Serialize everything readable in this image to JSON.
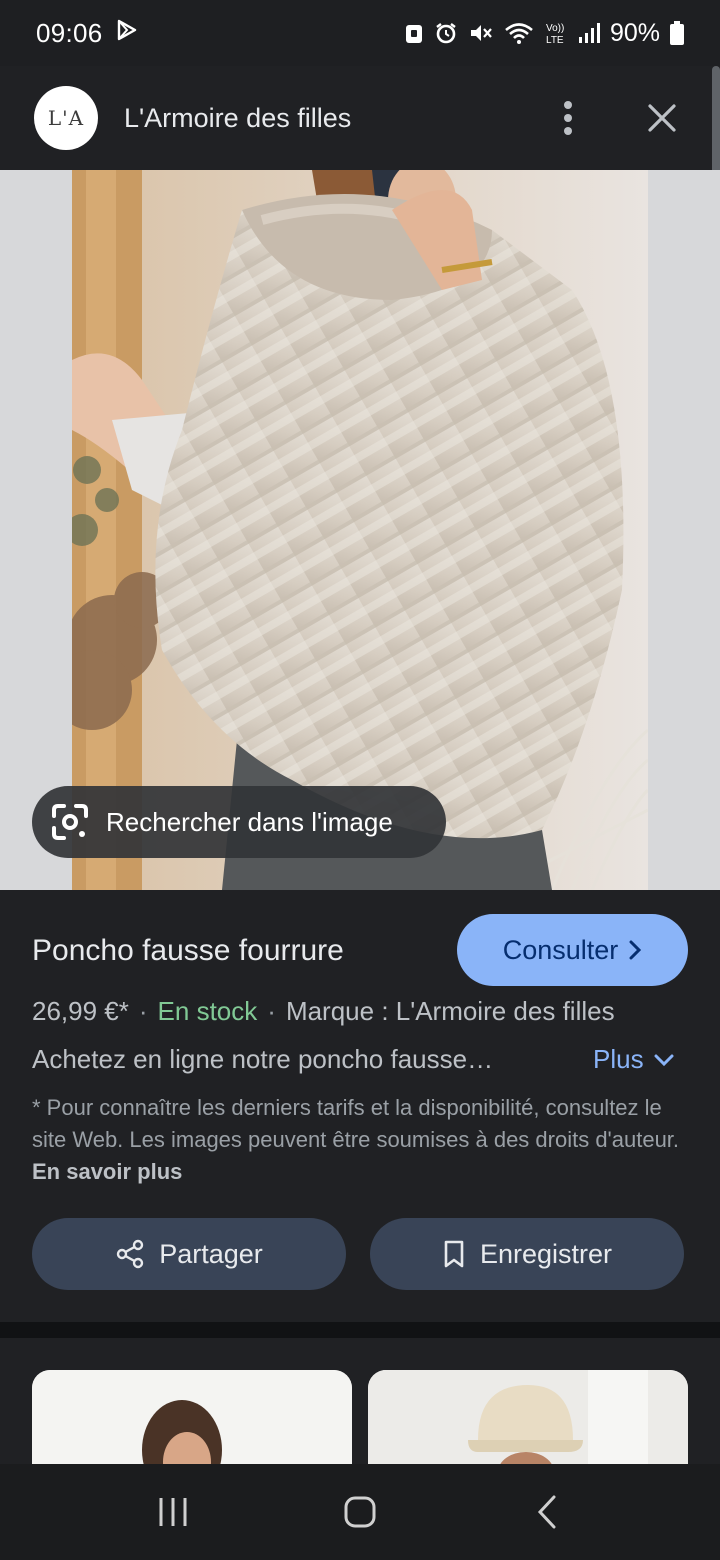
{
  "status_bar": {
    "time": "09:06",
    "battery": "90%",
    "network": "LTE"
  },
  "header": {
    "logo_text": "L'A",
    "site_name": "L'Armoire des filles"
  },
  "image": {
    "lens_button_label": "Rechercher dans l'image"
  },
  "product": {
    "title": "Poncho fausse fourrure",
    "visit_label": "Consulter",
    "price": "26,99 €*",
    "stock": "En stock",
    "brand": "Marque : L'Armoire des filles",
    "description": "Achetez en ligne notre poncho fausse…",
    "more_label": "Plus",
    "disclaimer": "* Pour connaître les derniers tarifs et la disponibilité, consultez le site Web. Les images peuvent être soumises à des droits d'auteur.",
    "learn_more": "En savoir plus"
  },
  "actions": {
    "share_label": "Partager",
    "save_label": "Enregistrer"
  },
  "colors": {
    "accent": "#8ab4f8",
    "stock_green": "#81c995",
    "background": "#202124",
    "chip": "#394457"
  }
}
